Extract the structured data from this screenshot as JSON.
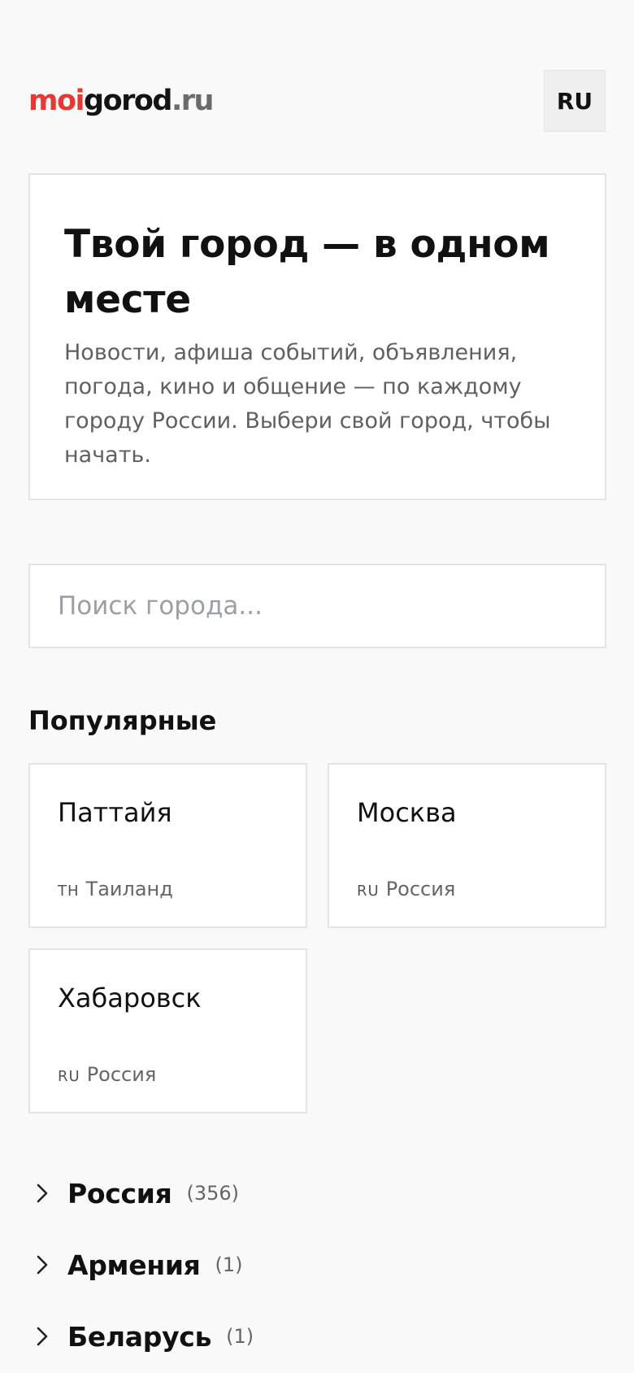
{
  "header": {
    "logo": {
      "part1": "moi",
      "part2": "gorod",
      "part3": ".ru"
    },
    "lang_label": "RU"
  },
  "hero": {
    "title": "Твой город — в одном месте",
    "text": "Новости, афиша событий, объявления, погода, кино и общение — по каждому городу России. Выбери свой город, чтобы начать."
  },
  "search": {
    "placeholder": "Поиск города...",
    "value": ""
  },
  "popular": {
    "title": "Популярные",
    "cities": [
      {
        "name": "Паттайя",
        "country_code": "TH",
        "country": "Таиланд"
      },
      {
        "name": "Москва",
        "country_code": "RU",
        "country": "Россия"
      },
      {
        "name": "Хабаровск",
        "country_code": "RU",
        "country": "Россия"
      }
    ]
  },
  "countries": [
    {
      "name": "Россия",
      "count": "(356)"
    },
    {
      "name": "Армения",
      "count": "(1)"
    },
    {
      "name": "Беларусь",
      "count": "(1)"
    }
  ],
  "colors": {
    "brand_red": "#e53935",
    "brand_dark": "#141414",
    "brand_gray": "#6b6b6b",
    "background": "#f9f9f9",
    "card_border": "#e4e4e4"
  },
  "icons": {
    "country_toggle": "chevron-right-icon"
  }
}
